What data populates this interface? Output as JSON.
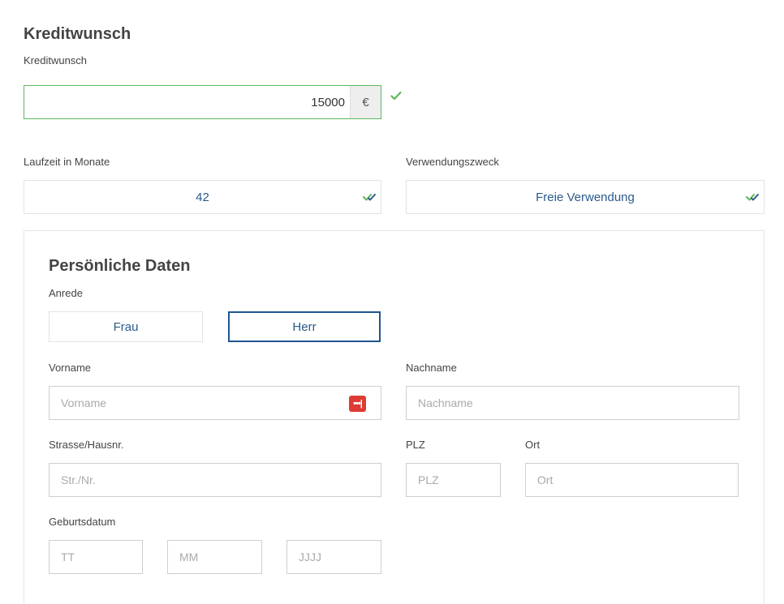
{
  "credit": {
    "heading": "Kreditwunsch",
    "amount_label": "Kreditwunsch",
    "amount_value": "15000",
    "currency_symbol": "€",
    "valid_icon": "check-icon"
  },
  "term": {
    "label": "Laufzeit in Monate",
    "value": "42",
    "icon": "double-check-icon"
  },
  "purpose": {
    "label": "Verwendungszweck",
    "value": "Freie Verwendung",
    "icon": "double-check-icon"
  },
  "personal": {
    "heading": "Persönliche Daten",
    "salutation_label": "Anrede",
    "salutation_options": [
      "Frau",
      "Herr"
    ],
    "salutation_selected": "Herr",
    "first_name_label": "Vorname",
    "first_name_placeholder": "Vorname",
    "password_manager_badge": "•••|",
    "last_name_label": "Nachname",
    "last_name_placeholder": "Nachname",
    "street_label": "Strasse/Hausnr.",
    "street_placeholder": "Str./Nr.",
    "zip_label": "PLZ",
    "zip_placeholder": "PLZ",
    "city_label": "Ort",
    "city_placeholder": "Ort",
    "birth_label": "Geburtsdatum",
    "birth_day_placeholder": "TT",
    "birth_month_placeholder": "MM",
    "birth_year_placeholder": "JJJJ"
  },
  "colors": {
    "accent_blue": "#1f5690",
    "valid_green": "#5cb85c",
    "badge_red": "#dd3b34"
  }
}
